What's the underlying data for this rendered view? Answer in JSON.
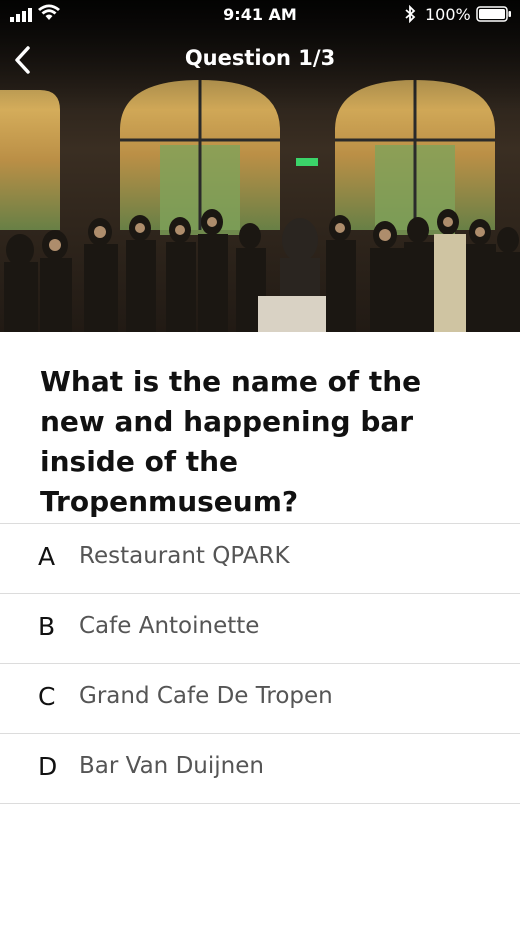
{
  "status_bar": {
    "time": "9:41 AM",
    "battery": "100%",
    "icons": [
      "signal-icon",
      "wifi-icon",
      "bluetooth-icon",
      "battery-icon"
    ]
  },
  "nav": {
    "title": "Question 1/3",
    "back_icon": "chevron-left-icon"
  },
  "hero": {
    "subject": "museum-hall-crowd-photo"
  },
  "question": {
    "text": "What is the name of the new and happening bar inside of the Tropenmuseum?"
  },
  "answers": [
    {
      "letter": "A",
      "label": "Restaurant QPARK"
    },
    {
      "letter": "B",
      "label": "Cafe Antoinette"
    },
    {
      "letter": "C",
      "label": "Grand Cafe De Tropen"
    },
    {
      "letter": "D",
      "label": "Bar Van Duijnen"
    }
  ],
  "colors": {
    "text": "#111111",
    "answer_text": "#555555",
    "divider": "#dcdcdc",
    "header_overlay": "#000000"
  }
}
